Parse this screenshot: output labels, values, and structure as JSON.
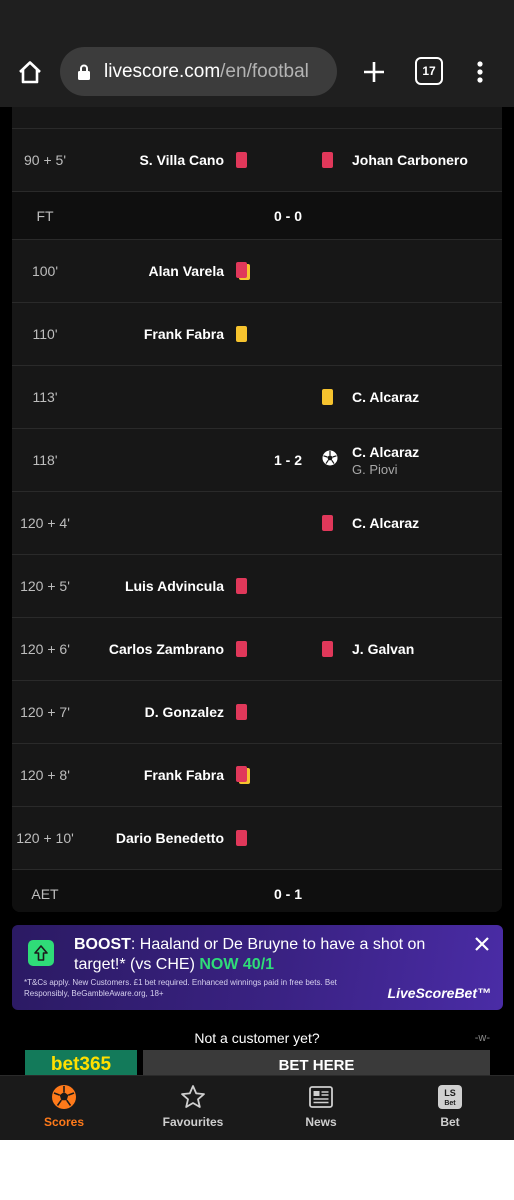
{
  "browser": {
    "url_main": "livescore.com",
    "url_path": "/en/footbal",
    "tab_count": "17"
  },
  "incidents": [
    {
      "time": "90 + 5'",
      "home_player": "S. Villa Cano",
      "home_icon": "red-card",
      "score": "",
      "away_icon": "red-card",
      "away_player": "Johan Carbonero",
      "away_sub": ""
    },
    {
      "type": "status",
      "label": "FT",
      "score": "0 - 0"
    },
    {
      "time": "100'",
      "home_player": "Alan Varela",
      "home_icon": "second-yellow-card",
      "score": "",
      "away_icon": "",
      "away_player": "",
      "away_sub": ""
    },
    {
      "time": "110'",
      "home_player": "Frank Fabra",
      "home_icon": "yellow-card",
      "score": "",
      "away_icon": "",
      "away_player": "",
      "away_sub": ""
    },
    {
      "time": "113'",
      "home_player": "",
      "home_icon": "",
      "score": "",
      "away_icon": "yellow-card",
      "away_player": "C. Alcaraz",
      "away_sub": ""
    },
    {
      "time": "118'",
      "home_player": "",
      "home_icon": "",
      "score": "1 - 2",
      "away_icon": "goal-ball",
      "away_player": "C. Alcaraz",
      "away_sub": "G. Piovi"
    },
    {
      "time": "120 + 4'",
      "home_player": "",
      "home_icon": "",
      "score": "",
      "away_icon": "red-card",
      "away_player": "C. Alcaraz",
      "away_sub": ""
    },
    {
      "time": "120 + 5'",
      "home_player": "Luis Advincula",
      "home_icon": "red-card",
      "score": "",
      "away_icon": "",
      "away_player": "",
      "away_sub": ""
    },
    {
      "time": "120 + 6'",
      "home_player": "Carlos Zambrano",
      "home_icon": "red-card",
      "score": "",
      "away_icon": "red-card",
      "away_player": "J. Galvan",
      "away_sub": ""
    },
    {
      "time": "120 + 7'",
      "home_player": "D. Gonzalez",
      "home_icon": "red-card",
      "score": "",
      "away_icon": "",
      "away_player": "",
      "away_sub": ""
    },
    {
      "time": "120 + 8'",
      "home_player": "Frank Fabra",
      "home_icon": "second-yellow-card",
      "score": "",
      "away_icon": "",
      "away_player": "",
      "away_sub": ""
    },
    {
      "time": "120 + 10'",
      "home_player": "Dario Benedetto",
      "home_icon": "red-card",
      "score": "",
      "away_icon": "",
      "away_player": "",
      "away_sub": ""
    },
    {
      "type": "status",
      "label": "AET",
      "score": "0 - 1"
    }
  ],
  "boost": {
    "label": "BOOST",
    "text": ": Haaland or De Bruyne to have a shot on target!* (vs CHE) ",
    "odds": "NOW 40/1",
    "terms": "*T&Cs apply. New Customers. £1 bet required. Enhanced winnings paid in free bets. Bet Responsibly, BeGambleAware.org, 18+",
    "brand": "LiveScoreBet™"
  },
  "promo": {
    "question": "Not a customer yet?",
    "marker": "-w-",
    "bookmaker": "bet365",
    "cta": "BET HERE"
  },
  "nav": {
    "scores": "Scores",
    "favourites": "Favourites",
    "news": "News",
    "bet": "Bet"
  },
  "colors": {
    "red_card": "#e0385a",
    "yellow_card": "#f6c32e",
    "active_tab": "#ff7a1a",
    "boost_green": "#2fdc78"
  }
}
